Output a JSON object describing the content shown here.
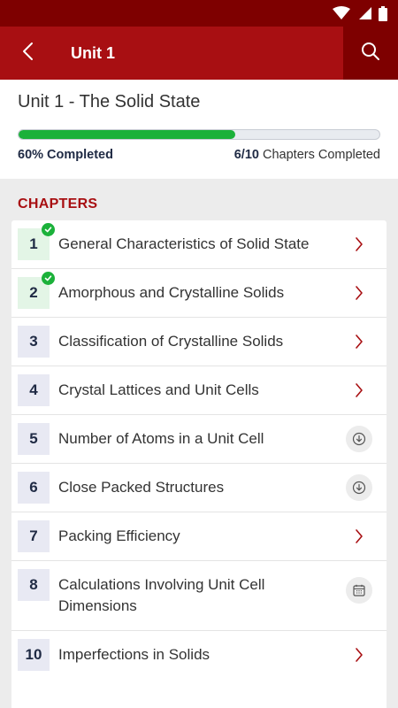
{
  "colors": {
    "status_bar": "#7e0000",
    "app_bar": "#a80f12",
    "accent": "#a80f12",
    "progress": "#1bb13a",
    "number_text": "#1f2a44"
  },
  "app_bar": {
    "title": "Unit 1",
    "back_icon": "chevron-left-icon",
    "search_icon": "search-icon"
  },
  "progress": {
    "unit_title": "Unit 1 - The Solid State",
    "percent": 60,
    "percent_label": "60% Completed",
    "chapters_count": "6/10",
    "chapters_label": "Chapters Completed"
  },
  "chapters": {
    "section_title": "CHAPTERS",
    "items": [
      {
        "number": "1",
        "title": "General Characteristics of Solid State",
        "completed": true,
        "action": "chevron-right-icon"
      },
      {
        "number": "2",
        "title": "Amorphous and Crystalline Solids",
        "completed": true,
        "action": "chevron-right-icon"
      },
      {
        "number": "3",
        "title": "Classification of Crystalline Solids",
        "completed": false,
        "action": "chevron-right-icon"
      },
      {
        "number": "4",
        "title": "Crystal Lattices and Unit Cells",
        "completed": false,
        "action": "chevron-right-icon"
      },
      {
        "number": "5",
        "title": "Number of Atoms in a Unit Cell",
        "completed": false,
        "action": "download-icon"
      },
      {
        "number": "6",
        "title": "Close Packed Structures",
        "completed": false,
        "action": "download-icon"
      },
      {
        "number": "7",
        "title": "Packing Efficiency",
        "completed": false,
        "action": "chevron-right-icon"
      },
      {
        "number": "8",
        "title": "Calculations Involving Unit Cell Dimensions",
        "completed": false,
        "action": "calendar-icon"
      },
      {
        "number": "10",
        "title": "Imperfections in Solids",
        "completed": false,
        "action": "chevron-right-icon"
      }
    ]
  }
}
